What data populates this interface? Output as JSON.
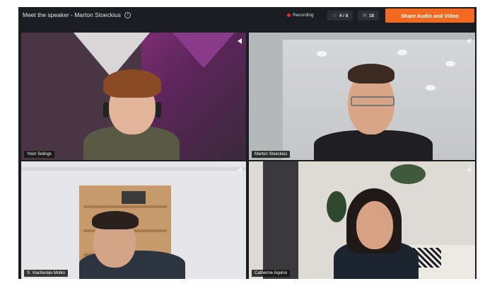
{
  "header": {
    "title": "Meet the speaker - Marton Stoeckius",
    "info_icon": "info-icon",
    "recording_label": "Recording",
    "participants_count": "4 / 8",
    "chat_count": "18",
    "share_button": "Share Audio and Video"
  },
  "tiles": [
    {
      "name": "Yoon Selings",
      "icon": "pin-flag-icon"
    },
    {
      "name": "Marton Stoeckius",
      "icon": "pin-flag-icon"
    },
    {
      "name": "S. Viacheslav Molko",
      "icon": "pin-flag-icon"
    },
    {
      "name": "Catherine Aquino",
      "icon": "pin-flag-icon"
    }
  ],
  "colors": {
    "accent": "#f26a21",
    "recording": "#e5302a",
    "background": "#1b1d22"
  }
}
